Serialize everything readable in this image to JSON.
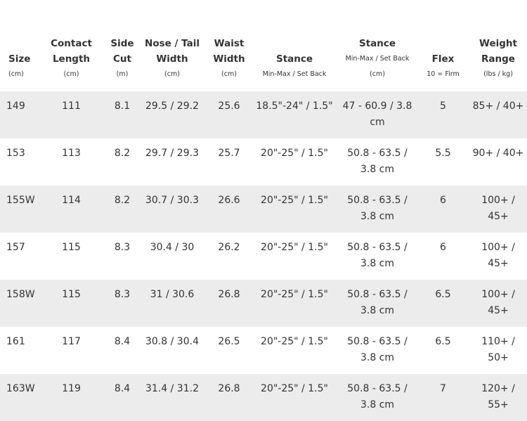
{
  "columns": [
    {
      "title": "Size",
      "unit": "(cm)"
    },
    {
      "title": "Contact Length",
      "unit": "(cm)"
    },
    {
      "title": "Side Cut",
      "unit": "(m)"
    },
    {
      "title": "Nose / Tail Width",
      "unit": "(cm)"
    },
    {
      "title": "Waist Width",
      "unit": "(cm)"
    },
    {
      "title": "Stance",
      "unit": "Min-Max / Set Back"
    },
    {
      "title": "Stance",
      "unit": "Min-Max / Set Back (cm)"
    },
    {
      "title": "Flex",
      "unit": "10 = Firm"
    },
    {
      "title": "Weight Range",
      "unit": "(lbs / kg)"
    }
  ],
  "rows": [
    [
      "149",
      "111",
      "8.1",
      "29.5 / 29.2",
      "25.6",
      "18.5\"-24\" / 1.5\"",
      "47 - 60.9 / 3.8 cm",
      "5",
      "85+ / 40+"
    ],
    [
      "153",
      "113",
      "8.2",
      "29.7 / 29.3",
      "25.7",
      "20\"-25\" / 1.5\"",
      "50.8 - 63.5 / 3.8 cm",
      "5.5",
      "90+ / 40+"
    ],
    [
      "155W",
      "114",
      "8.2",
      "30.7 / 30.3",
      "26.6",
      "20\"-25\" / 1.5\"",
      "50.8 - 63.5 / 3.8 cm",
      "6",
      "100+ / 45+"
    ],
    [
      "157",
      "115",
      "8.3",
      "30.4 / 30",
      "26.2",
      "20\"-25\" / 1.5\"",
      "50.8 - 63.5 / 3.8 cm",
      "6",
      "100+ / 45+"
    ],
    [
      "158W",
      "115",
      "8.3",
      "31 / 30.6",
      "26.8",
      "20\"-25\" / 1.5\"",
      "50.8 - 63.5 / 3.8 cm",
      "6.5",
      "100+ / 45+"
    ],
    [
      "161",
      "117",
      "8.4",
      "30.8 / 30.4",
      "26.5",
      "20\"-25\" / 1.5\"",
      "50.8 - 63.5 / 3.8 cm",
      "6.5",
      "110+ / 50+"
    ],
    [
      "163W",
      "119",
      "8.4",
      "31.4 / 31.2",
      "26.8",
      "20\"-25\" / 1.5\"",
      "50.8 - 63.5 / 3.8 cm",
      "7",
      "120+ / 55+"
    ]
  ]
}
